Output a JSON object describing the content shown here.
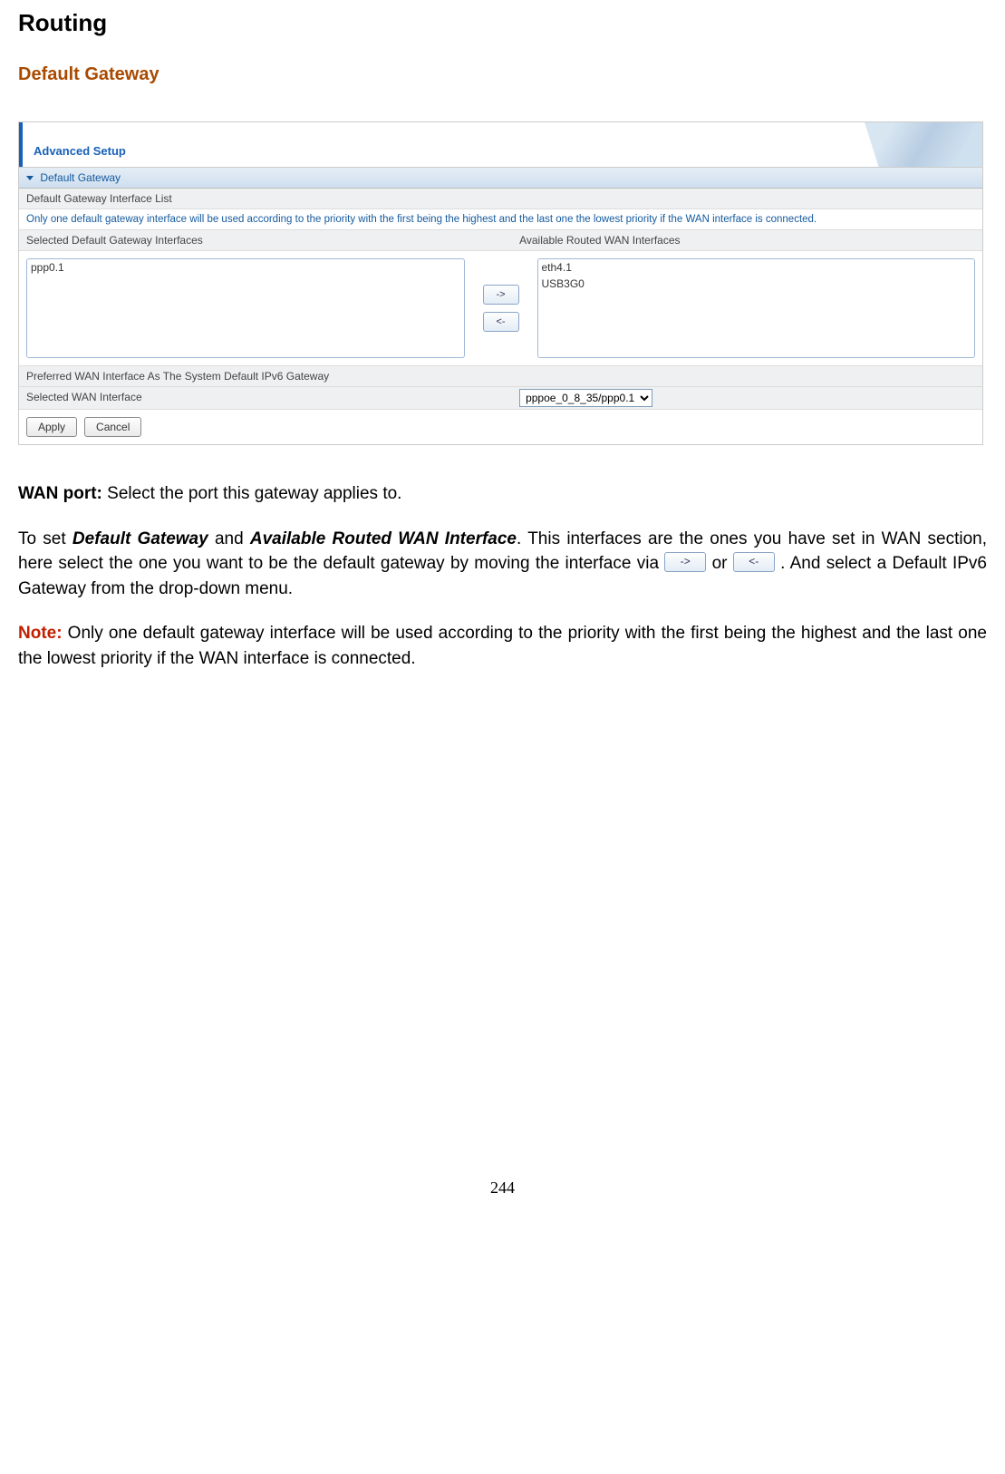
{
  "page_title": "Routing",
  "section_title": "Default Gateway",
  "panel": {
    "tab_label": "Advanced Setup",
    "accordion_label": "Default Gateway",
    "list_header": "Default Gateway Interface List",
    "info_text": "Only one default gateway interface will be used according to the priority with the first being the highest and the last one the lowest priority if the WAN interface is connected.",
    "selected_header": "Selected Default Gateway Interfaces",
    "selected_items": [
      "ppp0.1"
    ],
    "available_header": "Available Routed WAN Interfaces",
    "available_items": [
      "eth4.1",
      "USB3G0"
    ],
    "move_right": "->",
    "move_left": "<-",
    "ipv6_header": "Preferred WAN Interface As The System Default IPv6 Gateway",
    "ipv6_label": "Selected WAN Interface",
    "ipv6_value": "pppoe_0_8_35/ppp0.1",
    "apply": "Apply",
    "cancel": "Cancel"
  },
  "body": {
    "wan_label": "WAN port:",
    "wan_text": " Select the port this gateway applies to.",
    "para2_a": "To set ",
    "para2_b": "Default Gateway",
    "para2_c": " and ",
    "para2_d": "Available Routed WAN Interface",
    "para2_e": ". This interfaces are the ones you have set in WAN section, here select the one you want to be the default gateway by moving the interface via ",
    "para2_f": " or ",
    "para2_g": " .  And select a Default IPv6 Gateway from the drop-down menu.",
    "note_label": "Note:",
    "note_text": " Only one default gateway interface will be used according to the priority with the first being the highest and the last one the lowest priority if the WAN interface is connected.",
    "btn_right": "->",
    "btn_left": "<-"
  },
  "page_number": "244"
}
